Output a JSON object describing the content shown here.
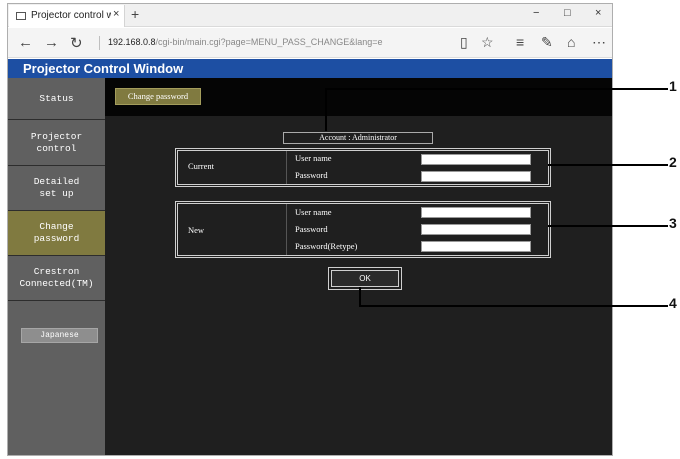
{
  "browser": {
    "tab_title": "Projector control windo",
    "tab_close": "×",
    "new_tab": "+",
    "minimize": "−",
    "maximize": "□",
    "close": "×",
    "url_host": "192.168.0.8",
    "url_path": "/cgi-bin/main.cgi?page=MENU_PASS_CHANGE&lang=e"
  },
  "page": {
    "title": "Projector Control Window"
  },
  "sidebar": {
    "items": [
      {
        "label": "Status"
      },
      {
        "label": "Projector\ncontrol"
      },
      {
        "label": "Detailed\nset up"
      },
      {
        "label": "Change\npassword"
      },
      {
        "label": "Crestron\nConnected(TM)"
      }
    ],
    "active_index": 3,
    "language_button": "Japanese"
  },
  "main": {
    "tab_label": "Change password",
    "account_label": "Account : Administrator",
    "current": {
      "label": "Current",
      "username_label": "User name",
      "username_value": "",
      "password_label": "Password",
      "password_value": ""
    },
    "new": {
      "label": "New",
      "username_label": "User name",
      "username_value": "",
      "password_label": "Password",
      "password_value": "",
      "retype_label": "Password(Retype)",
      "retype_value": ""
    },
    "ok_label": "OK"
  },
  "callouts": [
    "1",
    "2",
    "3",
    "4"
  ],
  "colors": {
    "header_blue": "#1d4fa3",
    "active_olive": "#807a40",
    "sidebar_gray": "#606060",
    "content_bg": "#1f1f1f"
  }
}
